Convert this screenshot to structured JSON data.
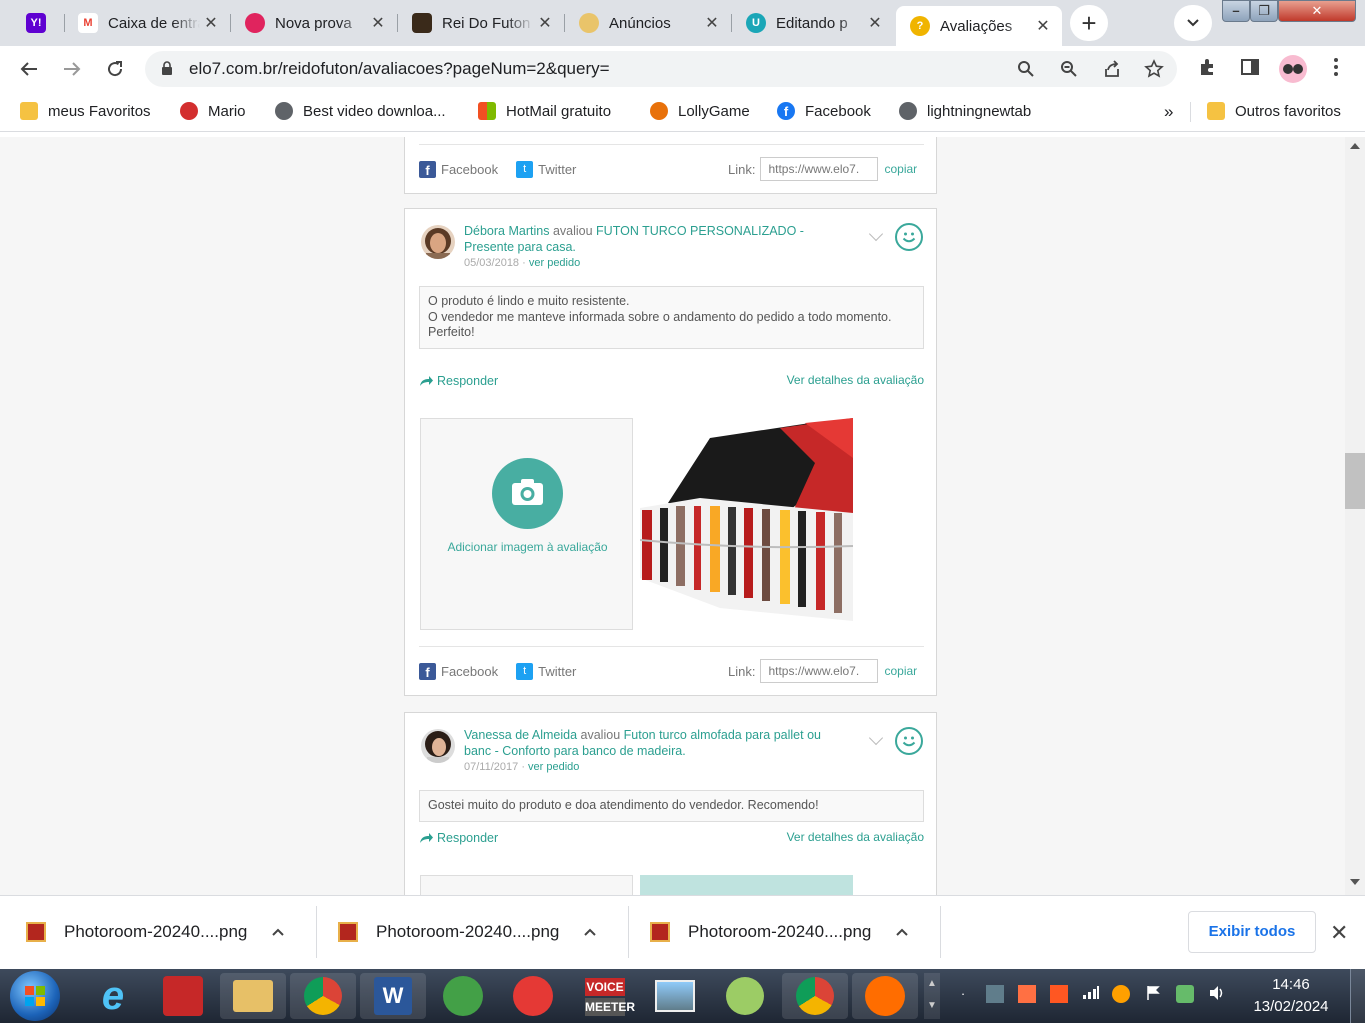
{
  "browser": {
    "tabs": [
      {
        "title": "",
        "icon": "yahoo-icon",
        "color": "#5f01d1"
      },
      {
        "title": "Caixa de entrada",
        "icon": "gmail-icon",
        "color": "#ea4335"
      },
      {
        "title": "Nova prova",
        "icon": "nova-prova-icon",
        "color": "#e0245e"
      },
      {
        "title": "Rei Do Futon",
        "icon": "reidofuton-icon",
        "color": "#3a2a1a"
      },
      {
        "title": "Anúncios",
        "icon": "anuncios-icon",
        "color": "#c89a3a"
      },
      {
        "title": "Editando p",
        "icon": "editando-icon",
        "color": "#1aa6b7"
      },
      {
        "title": "Avaliações",
        "icon": "avaliacoes-icon",
        "color": "#f0b400",
        "active": true
      }
    ],
    "new_tab_symbol": "+",
    "close_symbol": "✕",
    "url": "elo7.com.br/reidofuton/avaliacoes?pageNum=2&query=",
    "bookmarks": [
      {
        "label": "meus Favoritos",
        "icon": "folder-icon",
        "color": "#f5c242"
      },
      {
        "label": "Mario",
        "icon": "mario-icon",
        "color": "#d32f2f"
      },
      {
        "label": "Best video downloa...",
        "icon": "globe-icon",
        "color": "#5f6368"
      },
      {
        "label": "HotMail gratuito",
        "icon": "windows-icon",
        "color": "#f25022"
      },
      {
        "label": "LollyGame",
        "icon": "lollygame-icon",
        "color": "#e8710a"
      },
      {
        "label": "Facebook",
        "icon": "facebook-icon",
        "color": "#1877f2"
      },
      {
        "label": "lightningnewtab",
        "icon": "globe-icon",
        "color": "#5f6368"
      }
    ],
    "bookmarks_overflow": "»",
    "other_bookmarks": "Outros favoritos"
  },
  "page": {
    "share": {
      "facebook": "Facebook",
      "twitter": "Twitter",
      "link_label": "Link:",
      "link_value": "https://www.elo7.",
      "copy": "copiar"
    },
    "reviews": [
      {
        "author": "Débora Martins",
        "verb": "avaliou",
        "product": "FUTON TURCO PERSONALIZADO - Presente para casa.",
        "date": "05/03/2018",
        "date_sep": "·",
        "order_link": "ver pedido",
        "text": [
          "O produto é lindo e muito resistente.",
          "O vendedor me manteve informada sobre o andamento do pedido a todo momento.",
          "Perfeito!"
        ],
        "reply": "Responder",
        "details": "Ver detalhes da avaliação",
        "add_image": "Adicionar imagem à avaliação"
      },
      {
        "author": "Vanessa de Almeida",
        "verb": "avaliou",
        "product": "Futon turco almofada para pallet ou banc - Conforto para banco de madeira.",
        "date": "07/11/2017",
        "date_sep": "·",
        "order_link": "ver pedido",
        "text": [
          "Gostei muito do produto e doa atendimento do vendedor. Recomendo!"
        ],
        "reply": "Responder",
        "details": "Ver detalhes da avaliação"
      }
    ],
    "accent_color": "#2b9f90"
  },
  "downloads": {
    "items": [
      "Photoroom-20240....png",
      "Photoroom-20240....png",
      "Photoroom-20240....png"
    ],
    "show_all": "Exibir todos",
    "close_symbol": "✕"
  },
  "taskbar": {
    "apps": [
      {
        "name": "internet-explorer-icon",
        "label": "e",
        "color": "#1e73c8"
      },
      {
        "name": "acrobat-icon",
        "label": "",
        "color": "#c62828"
      },
      {
        "name": "file-explorer-icon",
        "label": "",
        "color": "#e7c067"
      },
      {
        "name": "chrome-icon",
        "label": "",
        "color": "#4caf50"
      },
      {
        "name": "word-icon",
        "label": "W",
        "color": "#2b579a"
      },
      {
        "name": "app-green-icon",
        "label": "",
        "color": "#43a047"
      },
      {
        "name": "app-red-icon",
        "label": "",
        "color": "#e53935"
      },
      {
        "name": "voicemeeter-icon",
        "label": "VOICE MEETER",
        "color": "#6b6b6b"
      },
      {
        "name": "photo-viewer-icon",
        "label": "",
        "color": "#90a4ae"
      },
      {
        "name": "app-lime-icon",
        "label": "",
        "color": "#9ccc65"
      },
      {
        "name": "chrome-profile-icon",
        "label": "",
        "color": "#4caf50"
      },
      {
        "name": "app-orange-icon",
        "label": "",
        "color": "#ff6d00"
      }
    ],
    "time": "14:46",
    "date": "13/02/2024"
  }
}
